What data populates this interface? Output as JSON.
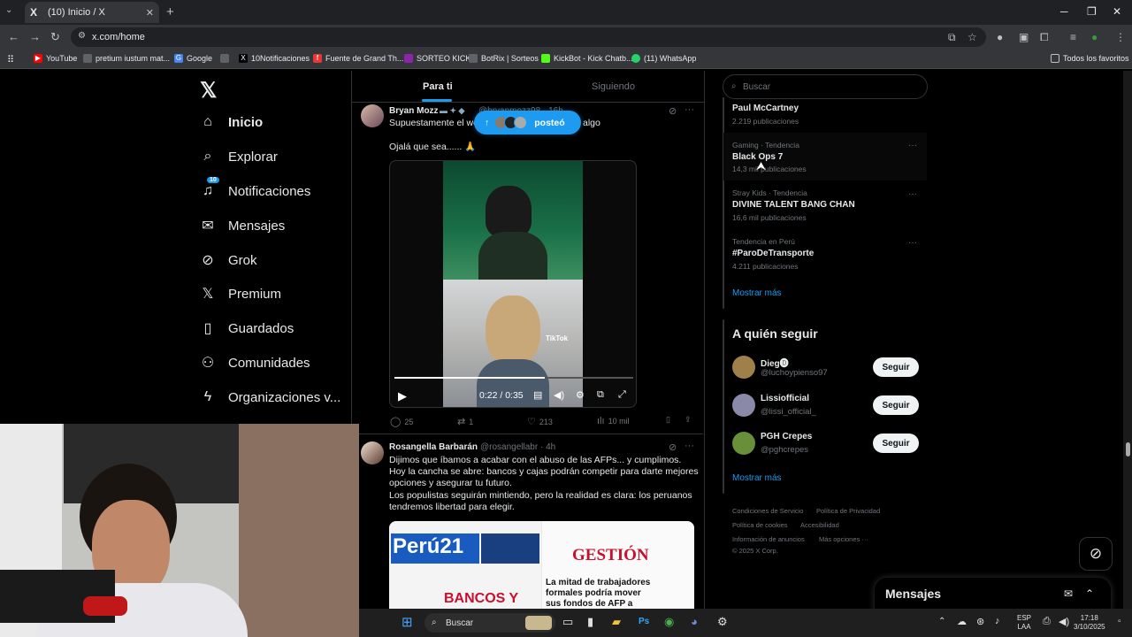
{
  "browser": {
    "tab_title": "(10) Inicio / X",
    "tab_favicon": "X",
    "url": "x.com/home",
    "bookmarks": [
      {
        "label": "YouTube",
        "color": "#ff0000"
      },
      {
        "label": "pretium iustum mat...",
        "color": "#5f6368"
      },
      {
        "label": "Google",
        "color": "#4285f4"
      },
      {
        "label": "",
        "color": "#5f6368"
      },
      {
        "label": "10Notificaciones",
        "color": "#000000"
      },
      {
        "label": "Fuente de Grand Th...",
        "color": "#e53935"
      },
      {
        "label": "SORTEO KICK",
        "color": "#8e24aa"
      },
      {
        "label": "BotRix | Sorteos",
        "color": "#5f6368"
      },
      {
        "label": "KickBot - Kick Chatb...",
        "color": "#53fc18"
      },
      {
        "label": "(11) WhatsApp",
        "color": "#25d366"
      }
    ],
    "all_bookmarks": "Todos los favoritos"
  },
  "sidebar": {
    "items": [
      {
        "label": "Inicio",
        "icon": "home-icon",
        "glyph": "⌂"
      },
      {
        "label": "Explorar",
        "icon": "search-icon",
        "glyph": "⌕"
      },
      {
        "label": "Notificaciones",
        "icon": "bell-icon",
        "glyph": "🔔",
        "badge": "10"
      },
      {
        "label": "Mensajes",
        "icon": "mail-icon",
        "glyph": "✉"
      },
      {
        "label": "Grok",
        "icon": "grok-icon",
        "glyph": "⊘"
      },
      {
        "label": "Premium",
        "icon": "x-icon",
        "glyph": "𝕏"
      },
      {
        "label": "Guardados",
        "icon": "bookmark-icon",
        "glyph": "⌑"
      },
      {
        "label": "Comunidades",
        "icon": "community-icon",
        "glyph": "⚇"
      },
      {
        "label": "Organizaciones v...",
        "icon": "lightning-icon",
        "glyph": "ϟ"
      }
    ]
  },
  "feed": {
    "tabs": [
      "Para ti",
      "Siguiendo"
    ],
    "posted_pill": "posteó",
    "tweet1": {
      "name": "Bryan Mozz",
      "handle": "@bryanmozz98 · 16h",
      "line1": "Supuestamente el we",
      "line1_tail": "algo",
      "line2": "Ojalá que sea...... 🙏",
      "video_time": "0:22 / 0:35",
      "video_progress": 0.63,
      "watermark": "TikTok",
      "replies": "25",
      "reposts": "1",
      "likes": "213",
      "views": "10 mil"
    },
    "tweet2": {
      "name": "Rosangella Barbarán",
      "handle": "@rosangellabr · 4h",
      "lines": [
        "Dijimos que íbamos a acabar con el abuso de las AFPs... y cumplimos.",
        "Hoy la cancha se abre: bancos y cajas podrán competir para darte mejores",
        "opciones y asegurar tu futuro.",
        "Los populistas seguirán mintiendo, pero la realidad es clara: los peruanos",
        "tendremos libertad para elegir."
      ],
      "news": {
        "peru21": "Perú21",
        "gestion": "GESTIÓN",
        "bancos": "BANCOS Y",
        "headline": [
          "La mitad de trabajadores",
          "formales podría mover",
          "sus fondos de AFP a"
        ]
      }
    }
  },
  "right": {
    "search_placeholder": "Buscar",
    "trends": [
      {
        "meta": "",
        "title": "Paul McCartney",
        "count": "2.219 publicaciones"
      },
      {
        "meta": "Gaming · Tendencia",
        "title": "Black Ops 7",
        "count": "14,3 mil publicaciones"
      },
      {
        "meta": "Stray Kids · Tendencia",
        "title": "DIVINE TALENT BANG CHAN",
        "count": "16,6 mil publicaciones"
      },
      {
        "meta": "Tendencia en Perú",
        "title": "#ParoDeTransporte",
        "count": "4.211 publicaciones"
      }
    ],
    "show_more": "Mostrar más",
    "who_to_follow": "A quién seguir",
    "follow_suggestions": [
      {
        "name": "Dieg🅓",
        "handle": "@luchoypienso97",
        "button": "Seguir",
        "color": "#a0804a"
      },
      {
        "name": "Lissiofficial",
        "handle": "@lissi_official_",
        "button": "Seguir",
        "color": "#8a8aa8"
      },
      {
        "name": "PGH Crepes",
        "handle": "@pghcrepes",
        "button": "Seguir",
        "color": "#6a8f3a"
      }
    ],
    "show_more_2": "Mostrar más",
    "footer": {
      "terms": "Condiciones de Servicio",
      "privacy": "Política de Privacidad",
      "cookies": "Política de cookies",
      "accessibility": "Accesibilidad",
      "ads": "Información de anuncios",
      "more": "Más opciones ···",
      "copyright": "© 2025 X Corp."
    }
  },
  "messages_drawer": {
    "title": "Mensajes"
  },
  "taskbar": {
    "search": "Buscar",
    "lang_top": "ESP",
    "lang_bottom": "LAA",
    "time": "17:18",
    "date": "3/10/2025"
  }
}
